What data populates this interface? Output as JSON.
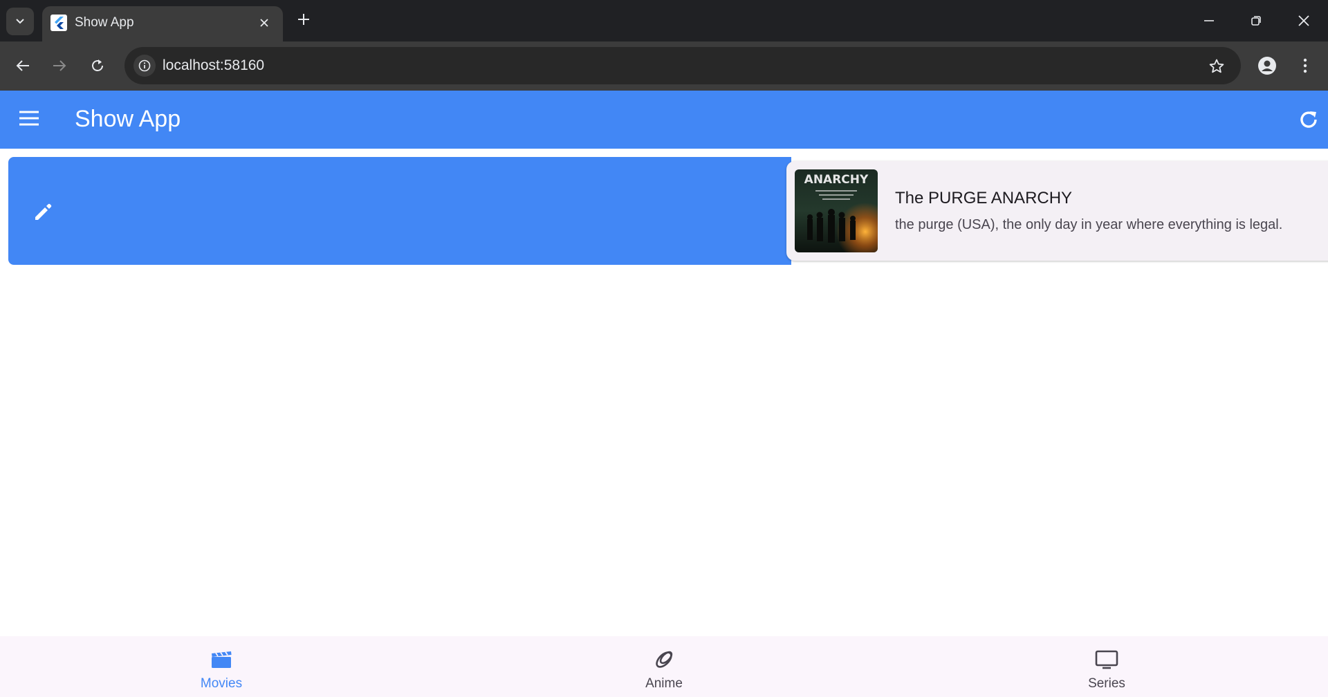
{
  "browser": {
    "tab_title": "Show App",
    "url": "localhost:58160",
    "icons": [
      "tab-search-icon",
      "flutter-favicon-icon",
      "close-icon",
      "plus-icon",
      "minimize-icon",
      "restore-icon",
      "window-close-icon",
      "back-arrow-icon",
      "forward-arrow-icon",
      "reload-icon",
      "site-info-icon",
      "star-icon",
      "profile-icon",
      "kebab-menu-icon"
    ]
  },
  "appbar": {
    "title": "Show App",
    "color": "#4287f5",
    "icons": [
      "hamburger-menu-icon",
      "refresh-icon"
    ]
  },
  "list": {
    "swipe_action_icon": "edit-pencil-icon",
    "items": [
      {
        "title": "The PURGE ANARCHY",
        "subtitle": "the purge (USA), the only day in year where everything is legal.",
        "poster_text": "ANARCHY"
      }
    ]
  },
  "bottom_nav": {
    "active_color": "#4287f5",
    "inactive_color": "#49454f",
    "items": [
      {
        "label": "Movies",
        "icon": "clapperboard-icon",
        "active": true
      },
      {
        "label": "Anime",
        "icon": "anime-rings-icon",
        "active": false
      },
      {
        "label": "Series",
        "icon": "tv-icon",
        "active": false
      }
    ]
  }
}
